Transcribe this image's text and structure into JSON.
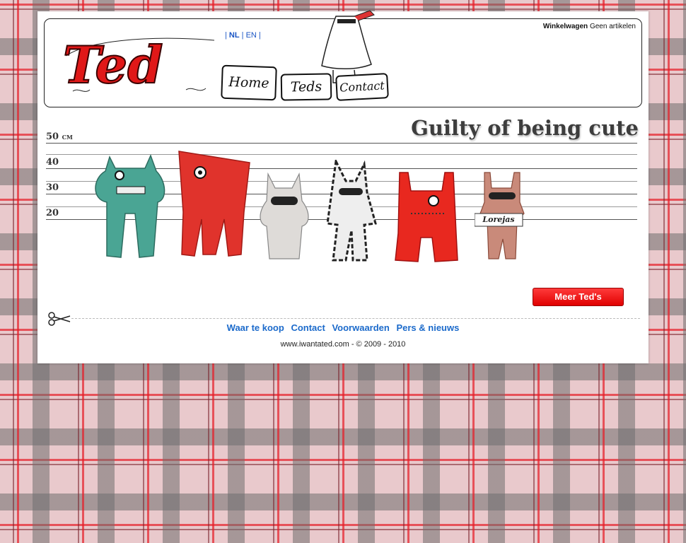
{
  "header": {
    "logo_text": "Ted",
    "languages": [
      {
        "label": "NL",
        "active": true
      },
      {
        "label": "EN",
        "active": false
      }
    ],
    "cart": {
      "label": "Winkelwagen",
      "status": "Geen artikelen"
    },
    "nav": [
      {
        "label": "Home"
      },
      {
        "label": "Teds"
      },
      {
        "label": "Contact"
      }
    ]
  },
  "banner": {
    "tagline": "Guilty of being cute",
    "height_marks": [
      {
        "value": "50",
        "unit": "CM"
      },
      {
        "value": "40",
        "unit": ""
      },
      {
        "value": "30",
        "unit": ""
      },
      {
        "value": "20",
        "unit": ""
      }
    ],
    "sign_text": "Lorejas"
  },
  "more_button": "Meer Ted's",
  "footer": {
    "links": [
      "Waar te koop",
      "Contact",
      "Voorwaarden",
      "Pers & nieuws"
    ],
    "copyright": "www.iwantated.com - © 2009 - 2010"
  },
  "colors": {
    "accent_red": "#e00000",
    "link_blue": "#1b6acb"
  }
}
